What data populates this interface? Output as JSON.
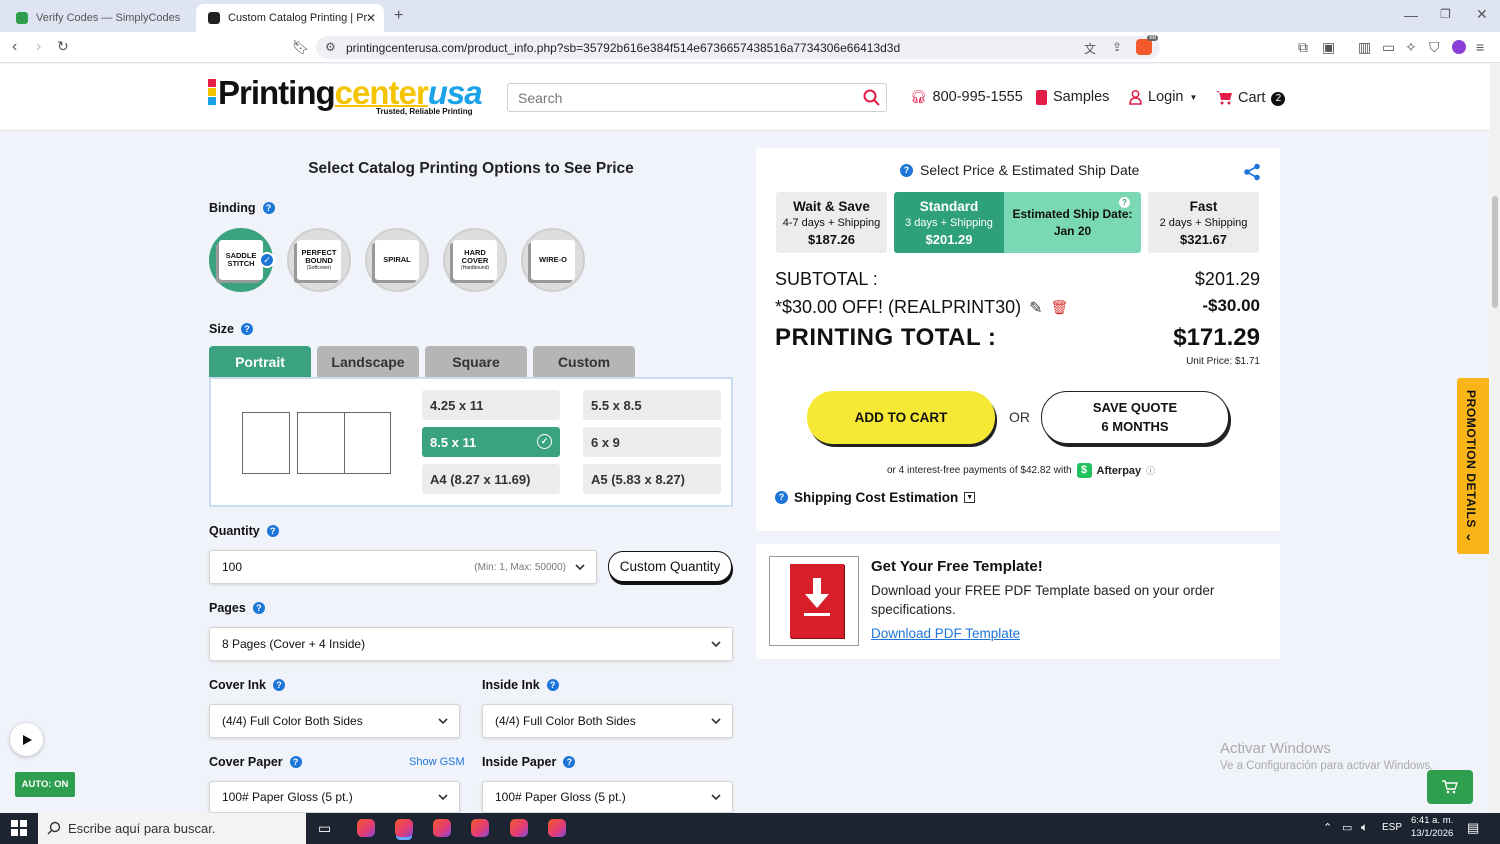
{
  "browser": {
    "tabs": [
      {
        "title": "Verify Codes — SimplyCodes",
        "active": false
      },
      {
        "title": "Custom Catalog Printing | Printin",
        "active": true
      }
    ],
    "url": "printingcenterusa.com/product_info.php?sb=35792b616e384f514e6736657438516a7734306e66413d3d",
    "ext_badge": "88"
  },
  "header": {
    "logo_text_a": "Printing",
    "logo_text_b": "center",
    "logo_text_c": "usa",
    "logo_tagline": "Trusted, Reliable Printing",
    "search_placeholder": "Search",
    "phone": "800-995-1555",
    "samples": "Samples",
    "login": "Login",
    "cart": "Cart",
    "cart_count": "2"
  },
  "options": {
    "heading": "Select Catalog Printing Options to See Price",
    "binding_label": "Binding",
    "binding": [
      {
        "line1": "SADDLE",
        "line2": "STITCH",
        "note": "",
        "selected": true
      },
      {
        "line1": "PERFECT",
        "line2": "BOUND",
        "note": "(Softcover)",
        "selected": false
      },
      {
        "line1": "SPIRAL",
        "line2": "",
        "note": "",
        "selected": false
      },
      {
        "line1": "HARD",
        "line2": "COVER",
        "note": "(Hardbound)",
        "selected": false
      },
      {
        "line1": "WIRE-O",
        "line2": "",
        "note": "",
        "selected": false
      }
    ],
    "size_label": "Size",
    "size_tabs": [
      "Portrait",
      "Landscape",
      "Square",
      "Custom"
    ],
    "sizes": [
      "4.25 x 11",
      "5.5 x 8.5",
      "8.5 x 11",
      "6 x 9",
      "A4 (8.27 x 11.69)",
      "A5 (5.83 x 8.27)"
    ],
    "selected_size": "8.5 x 11",
    "quantity_label": "Quantity",
    "quantity_value": "100",
    "quantity_hint": "(Min: 1, Max: 50000)",
    "custom_quantity": "Custom Quantity",
    "pages_label": "Pages",
    "pages_value": "8 Pages (Cover + 4 Inside)",
    "cover_ink_label": "Cover Ink",
    "cover_ink_value": "(4/4) Full Color Both Sides",
    "inside_ink_label": "Inside Ink",
    "inside_ink_value": "(4/4) Full Color Both Sides",
    "cover_paper_label": "Cover Paper",
    "show_gsm": "Show GSM",
    "cover_paper_value": "100# Paper Gloss (5 pt.)",
    "inside_paper_label": "Inside Paper",
    "inside_paper_value": "100# Paper Gloss (5 pt.)"
  },
  "price": {
    "heading": "Select Price & Estimated Ship Date",
    "turnaround": [
      {
        "title": "Wait & Save",
        "days": "4-7 days + Shipping",
        "price": "$187.26",
        "selected": false
      },
      {
        "title": "Standard",
        "days": "3 days + Shipping",
        "price": "$201.29",
        "selected": true
      },
      {
        "title": "Fast",
        "days": "2 days + Shipping",
        "price": "$321.67",
        "selected": false
      }
    ],
    "ship_date_label": "Estimated Ship Date:",
    "ship_date": "Jan 20",
    "subtotal_label": "SUBTOTAL :",
    "subtotal": "$201.29",
    "discount_label": "*$30.00 OFF! (REALPRINT30)",
    "discount": "-$30.00",
    "total_label": "PRINTING TOTAL :",
    "total": "$171.29",
    "unit_price": "Unit Price: $1.71",
    "add_to_cart": "ADD TO CART",
    "or": "OR",
    "save_quote_1": "SAVE QUOTE",
    "save_quote_2": "6 MONTHS",
    "afterpay_text": "or 4 interest-free payments of $42.82 with",
    "afterpay_brand": "Afterpay",
    "shipping_estimation": "Shipping Cost Estimation"
  },
  "template": {
    "title": "Get Your Free Template!",
    "desc": "Download your FREE PDF Template based on your order specifications.",
    "link": "Download PDF Template"
  },
  "promo": "PROMOTION DETAILS",
  "auto_badge": "AUTO: ON",
  "watermark": {
    "line1": "Activar Windows",
    "line2": "Ve a Configuración para activar Windows."
  },
  "taskbar": {
    "search": "Escribe aquí para buscar.",
    "lang": "ESP",
    "time": "6:41 a. m.",
    "date": "13/1/2026"
  },
  "colors": {
    "accent_green": "#3aa27f",
    "brand_blue": "#1d75d8",
    "cart_yellow": "#f5e936",
    "promo_orange": "#f9b417",
    "delete_red": "#d9322f"
  }
}
